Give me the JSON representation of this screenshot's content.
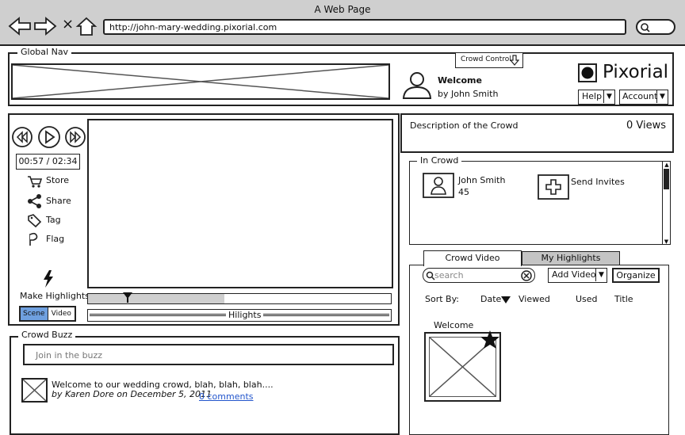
{
  "browser": {
    "title": "A Web Page",
    "url": "http://john-mary-wedding.pixorial.com",
    "close_glyph": "×"
  },
  "global_nav": {
    "legend": "Global Nav",
    "crowd_control": "Crowd Control",
    "welcome": "Welcome",
    "by_user": "by John Smith",
    "logo": "Pixorial",
    "help": "Help",
    "account": "Account"
  },
  "player": {
    "time": "00:57 / 02:34",
    "actions": [
      {
        "label": "Store",
        "icon": "cart-icon"
      },
      {
        "label": "Share",
        "icon": "share-icon"
      },
      {
        "label": "Tag",
        "icon": "tag-icon"
      },
      {
        "label": "Flag",
        "icon": "flag-icon"
      }
    ],
    "make_highlights": "Make Highlights",
    "scene": "Scene",
    "video": "Video",
    "hilights": "Hilights",
    "progress": 0.45
  },
  "crowd": {
    "description": "Description of the Crowd",
    "views": "0 Views"
  },
  "in_crowd": {
    "legend": "In Crowd",
    "member_name": "John Smith",
    "member_count": "45",
    "send_invites": "Send Invites"
  },
  "videos": {
    "tabs": [
      "Crowd Video",
      "My Highlights"
    ],
    "search_placeholder": "search",
    "add_video": "Add Video",
    "organize": "Organize",
    "sort_by": "Sort By:",
    "sort_columns": [
      "Date",
      "Viewed",
      "Used",
      "Title"
    ],
    "item_title": "Welcome"
  },
  "crowd_buzz": {
    "legend": "Crowd Buzz",
    "placeholder": "Join in the buzz",
    "comment_text": "Welcome to our wedding crowd, blah, blah, blah....",
    "comment_meta": "by Karen Dore on December 5, 2011",
    "comments_link": "0 comments"
  }
}
